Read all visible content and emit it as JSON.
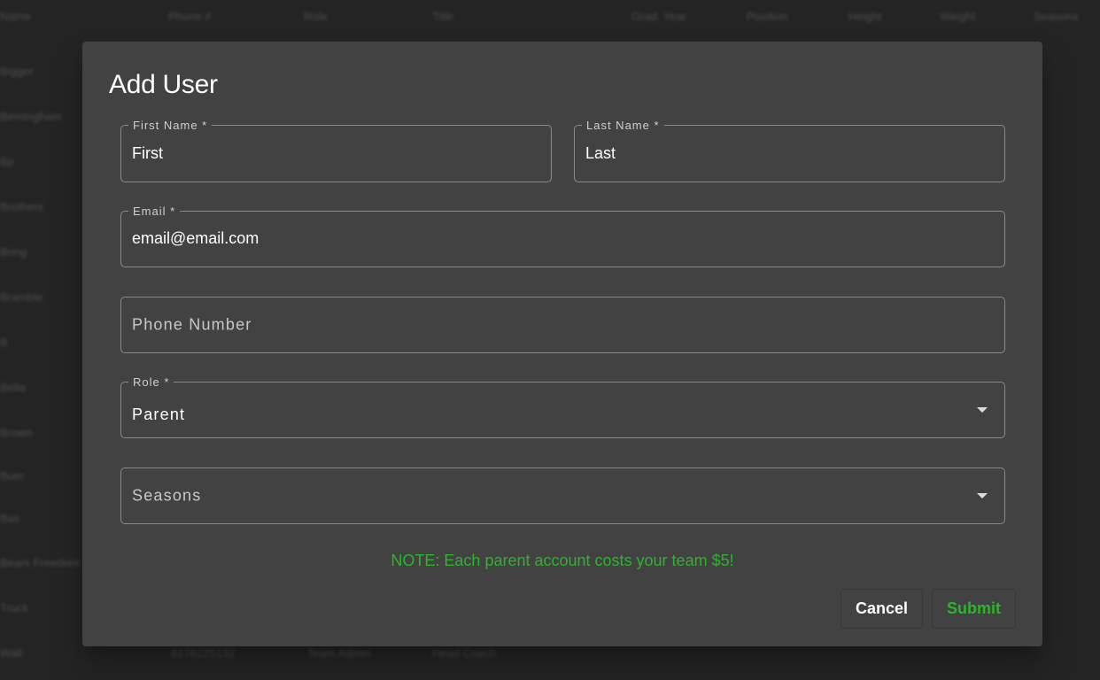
{
  "background": {
    "columns": [
      "Name",
      "Phone #",
      "Role",
      "Title",
      "Grad. Year",
      "Position",
      "Height",
      "Weight",
      "Seasons"
    ],
    "names": [
      "Bigger",
      "Birmingham",
      "Bp",
      "Brothers",
      "Bring",
      "Bramble",
      "B",
      "Bella",
      "Brown",
      "Boer",
      "Bas",
      "Bears Freedom",
      "Truck",
      "Wall"
    ],
    "row": [
      "8176225132",
      "Team Admin",
      "Head Coach"
    ]
  },
  "modal": {
    "title": "Add User",
    "fields": {
      "first_name": {
        "label": "First Name *",
        "value": "First"
      },
      "last_name": {
        "label": "Last Name *",
        "value": "Last"
      },
      "email": {
        "label": "Email *",
        "value": "email@email.com"
      },
      "phone": {
        "placeholder": "Phone Number"
      },
      "role": {
        "label": "Role *",
        "value": "Parent"
      },
      "seasons": {
        "placeholder": "Seasons"
      }
    },
    "note": "NOTE: Each parent account costs your team $5!",
    "cancel_label": "Cancel",
    "submit_label": "Submit"
  },
  "colors": {
    "accent": "#2bb52b",
    "modal_bg": "#424242",
    "backdrop": "#242424"
  },
  "icons": {
    "dropdown": "caret-down-icon"
  }
}
